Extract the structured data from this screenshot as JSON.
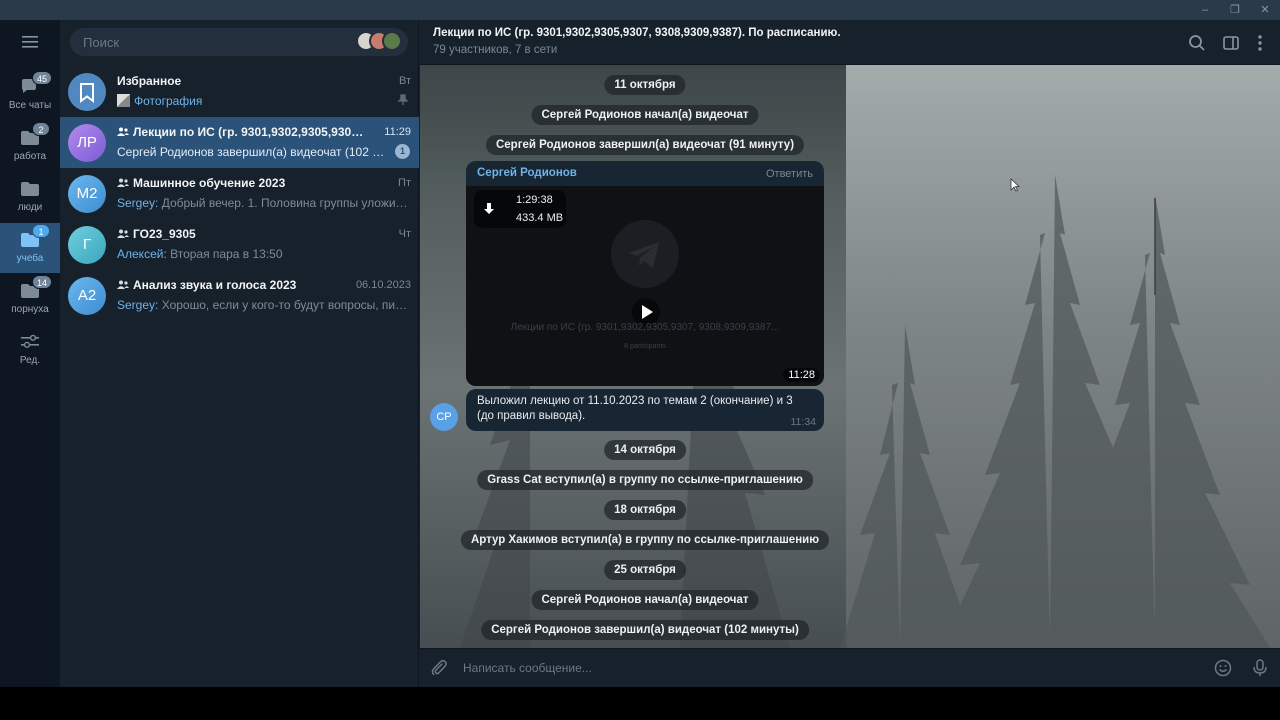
{
  "window": {
    "min_icon": "minimize-icon",
    "max_icon": "restore-icon",
    "close_icon": "close-icon"
  },
  "folders": [
    {
      "label": "Все чаты",
      "badge": "45",
      "icon": "chats-icon"
    },
    {
      "label": "работа",
      "badge": "2",
      "icon": "folder-icon"
    },
    {
      "label": "люди",
      "badge": "",
      "icon": "folder-icon"
    },
    {
      "label": "учеба",
      "badge": "1",
      "icon": "folder-icon",
      "active": true
    },
    {
      "label": "порнуха",
      "badge": "14",
      "icon": "folder-icon"
    },
    {
      "label": "Ред.",
      "badge": "",
      "icon": "edit-filters-icon"
    }
  ],
  "search": {
    "placeholder": "Поиск"
  },
  "chats": [
    {
      "initials": "",
      "color": "#5288c1",
      "name": "Избранное",
      "time": "Вт",
      "message": "Фотография",
      "sender": "",
      "pinned": true,
      "group": false
    },
    {
      "initials": "ЛР",
      "color": "#9a6fd8",
      "name": "Лекции по ИС (гр. 9301,9302,9305,9307, 9308,9309,9387). По расписанию.",
      "time": "11:29",
      "message": "Сергей Родионов завершил(а) видеочат (102 минуты)",
      "sender": "",
      "unread": "1",
      "group": true,
      "active": true
    },
    {
      "initials": "М2",
      "color": "#4a9ad4",
      "name": "Машинное обучение 2023",
      "time": "Пт",
      "message": "Добрый вечер. 1. Половина группы уложилась в срок",
      "sender": "Sergey: ",
      "group": true
    },
    {
      "initials": "Г",
      "color": "#47b3c7",
      "name": "ГО23_9305",
      "time": "Чт",
      "message": "Вторая пара в 13:50",
      "sender": "Алексей: ",
      "group": true
    },
    {
      "initials": "А2",
      "color": "#4a9ad4",
      "name": "Анализ звука и голоса 2023",
      "time": "06.10.2023",
      "message": "Хорошо, если у кого-то будут вопросы, пишите сюда",
      "sender": "Sergey: ",
      "group": true
    }
  ],
  "header": {
    "title": "Лекции по ИС (гр. 9301,9302,9305,9307, 9308,9309,9387). По расписанию.",
    "subtitle": "79 участников, 7 в сети"
  },
  "messages": {
    "pill1": "11 октября",
    "pill2": "Сергей Родионов начал(а) видеочат",
    "pill3": "Сергей Родионов завершил(а) видеочат (91 минуту)",
    "video_from": "Сергей Родионов",
    "video_reply": "Ответить",
    "video_duration": "1:29:38",
    "video_size": "433.4 MB",
    "video_ghost_title": "Лекции по ИС (гр. 9301,9302,9305,9307, 9308,9309,9387...",
    "video_ghost_sub": "8 participants",
    "video_time": "11:28",
    "text": "Выложил лекцию от 11.10.2023 по темам 2  (окончание) и 3 (до правил вывода).",
    "text_time": "11:34",
    "sender_initials": "СР",
    "pill4": "14 октября",
    "pill5": "Grass Cat вступил(а) в группу по ссылке-приглашению",
    "pill6": "18 октября",
    "pill7": "Артур Хакимов вступил(а) в группу по ссылке-приглашению",
    "pill8": "25 октября",
    "pill9": "Сергей Родионов начал(а) видеочат",
    "pill10": "Сергей Родионов завершил(а) видеочат (102 минуты)"
  },
  "composer": {
    "placeholder": "Написать сообщение..."
  },
  "colors": {
    "accent": "#2b5278",
    "link": "#6fb3e7",
    "bg": "#17212b",
    "rail": "#0e1621"
  }
}
